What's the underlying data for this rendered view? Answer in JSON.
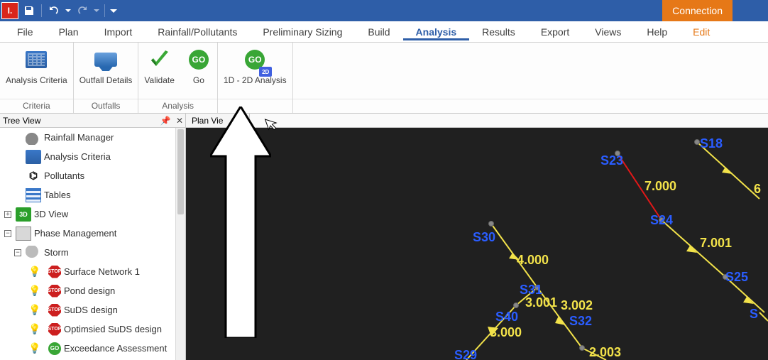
{
  "titlebar": {
    "connection_label": "Connection"
  },
  "menu": {
    "file": "File",
    "plan": "Plan",
    "import": "Import",
    "rainfall": "Rainfall/Pollutants",
    "prelim": "Preliminary Sizing",
    "build": "Build",
    "analysis": "Analysis",
    "results": "Results",
    "export": "Export",
    "views": "Views",
    "help": "Help",
    "edit": "Edit"
  },
  "ribbon": {
    "criteria_btn": "Analysis Criteria",
    "outfall_btn": "Outfall Details",
    "validate_btn": "Validate",
    "go_btn": "Go",
    "analysis_1d2d_btn": "1D - 2D Analysis",
    "group_criteria": "Criteria",
    "group_outfalls": "Outfalls",
    "group_analysis": "Analysis",
    "go_text": "GO",
    "badge2d": "2D"
  },
  "tree": {
    "panel_title": "Tree View",
    "items": {
      "rainfall_manager": "Rainfall Manager",
      "analysis_criteria": "Analysis Criteria",
      "pollutants": "Pollutants",
      "tables": "Tables",
      "view3d": "3D View",
      "phase_mgmt": "Phase Management",
      "storm": "Storm",
      "surface_network": "Surface Network 1",
      "pond_design": "Pond design",
      "suds_design": "SuDS design",
      "optimised_suds": "Optimsied SuDS design",
      "exceedance": "Exceedance Assessment"
    },
    "icon_labels": {
      "cube3d": "3D",
      "stop": "STOP",
      "go": "GO"
    }
  },
  "planview": {
    "tab_title": "Plan Vie",
    "nodes": {
      "s18": "S18",
      "s23": "S23",
      "s24": "S24",
      "s25": "S25",
      "s30": "S30",
      "s31": "S31",
      "s32": "S32",
      "s40": "S40",
      "s29": "S29"
    },
    "labels": {
      "l7000": "7.000",
      "l7001": "7.001",
      "l6": "6",
      "l4000": "4.000",
      "l3001": "3.001",
      "l3002": "3.002",
      "l3000": "3.000",
      "l2003": "2.003"
    }
  }
}
